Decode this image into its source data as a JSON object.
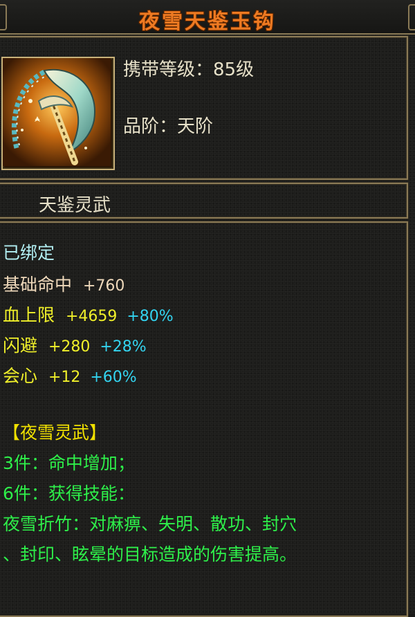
{
  "title": "夜雪天鉴玉钩",
  "item": {
    "icon": "jade-hook-weapon-icon",
    "level_line": "携带等级：85级",
    "grade_line": "品阶：天阶"
  },
  "subtitle": "天鉴灵武",
  "status": "已绑定",
  "stats": [
    {
      "name": "基础命中",
      "value": "+760",
      "bonus": ""
    },
    {
      "name": "血上限",
      "value": "+4659",
      "bonus": "+80%"
    },
    {
      "name": "闪避",
      "value": "+280",
      "bonus": "+28%"
    },
    {
      "name": "会心",
      "value": "+12",
      "bonus": "+60%"
    }
  ],
  "set": {
    "header": "【夜雪灵武】",
    "bonus3": "3件：命中增加；",
    "bonus6": "6件：获得技能：",
    "skill_line1": "夜雪折竹：对麻痹、失明、散功、封穴",
    "skill_line2": "、封印、眩晕的目标造成的伤害提高。"
  },
  "colors": {
    "title": "#ee7a22",
    "border": "#8a7a56",
    "bound": "#b3f0f4",
    "base_stat": "#efd9bb",
    "stat": "#f0f02a",
    "bonus": "#33d4f0",
    "set_text": "#2ef04a",
    "set_header": "#f0e000"
  }
}
